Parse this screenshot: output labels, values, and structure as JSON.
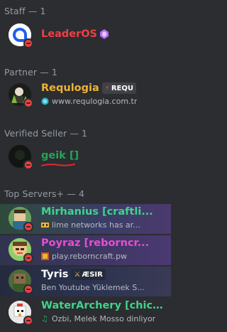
{
  "sections": {
    "staff": "Staff — 1",
    "partner": "Partner — 1",
    "verified": "Verified Seller — 1",
    "top": "Top Servers+ — 4"
  },
  "members": {
    "leaderos": {
      "name": "LeaderOS",
      "color": "#f23f43"
    },
    "requlogia": {
      "name": "Requlogia",
      "color": "#f0b232",
      "tag": "REQU",
      "sub": "www.requlogia.com.tr"
    },
    "geik": {
      "name": "geik []",
      "color": "#23a55a"
    },
    "mirhanius": {
      "name": "Mirhanius [craftli...",
      "color": "#3fd48a",
      "sub": "lime networks has ar..."
    },
    "poyraz": {
      "name": "Poyraz [reborncr...",
      "color": "#e64fd1",
      "sub": "play.reborncraft.pw"
    },
    "tyris": {
      "name": "Tyris",
      "color": "#ffffff",
      "tag": "ÆSIR",
      "sub": "Ben Youtube Yüklemek S..."
    },
    "waterarchery": {
      "name": "WaterArchery [chicke...",
      "color": "#3fd48a",
      "sub": "Ozbi, Melek Mosso dinliyor"
    }
  },
  "icons": {
    "status": "do-not-disturb-icon",
    "gem": "gem-icon",
    "tag_bolt": "bolt-icon",
    "tag_swords": "swords-icon",
    "globe": "globe-icon",
    "music": "music-note-icon",
    "game": "game-icon"
  }
}
